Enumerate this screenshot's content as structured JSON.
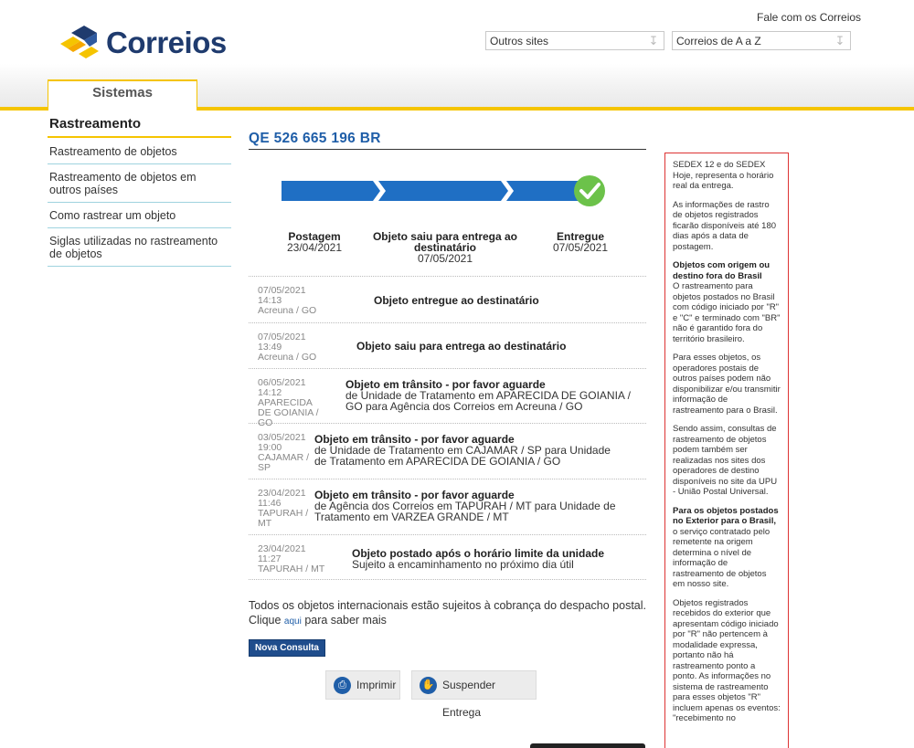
{
  "header": {
    "logo_text": "Correios",
    "fale_link": "Fale com os Correios",
    "select_outros": "Outros sites",
    "select_az": "Correios de A a Z",
    "tab_label": "Sistemas"
  },
  "sidebar": {
    "title": "Rastreamento",
    "items": [
      {
        "label": "Rastreamento de objetos"
      },
      {
        "label": "Rastreamento de objetos em outros países"
      },
      {
        "label": "Como rastrear um objeto"
      },
      {
        "label": "Siglas utilizadas no rastreamento de objetos"
      }
    ]
  },
  "tracking": {
    "code": "QE 526 665 196 BR",
    "progress_steps_completed": 3,
    "progress_steps_total": 3,
    "summary": {
      "posted_label": "Postagem",
      "posted_date": "23/04/2021",
      "out_label": "Objeto saiu para entrega ao destinatário",
      "out_date": "07/05/2021",
      "delivered_label": "Entregue",
      "delivered_date": "07/05/2021"
    },
    "events": [
      {
        "date": "07/05/2021",
        "time": "14:13",
        "place": "Acreuna / GO",
        "title": "Objeto entregue ao destinatário",
        "detail": ""
      },
      {
        "date": "07/05/2021",
        "time": "13:49",
        "place": "Acreuna / GO",
        "title": "Objeto saiu para entrega ao destinatário",
        "detail": ""
      },
      {
        "date": "06/05/2021",
        "time": "14:12",
        "place": "APARECIDA DE GOIANIA / GO",
        "title": "Objeto em trânsito - por favor aguarde",
        "detail": "de Unidade de Tratamento em APARECIDA DE GOIANIA / GO para Agência dos Correios em Acreuna / GO"
      },
      {
        "date": "03/05/2021",
        "time": "19:00",
        "place": "CAJAMAR / SP",
        "title": "Objeto em trânsito - por favor aguarde",
        "detail": "de Unidade de Tratamento em CAJAMAR / SP para Unidade de Tratamento em APARECIDA DE GOIANIA / GO"
      },
      {
        "date": "23/04/2021",
        "time": "11:46",
        "place": "TAPURAH / MT",
        "title": "Objeto em trânsito - por favor aguarde",
        "detail": "de Agência dos Correios em TAPURAH / MT para Unidade de Tratamento em VARZEA GRANDE / MT"
      },
      {
        "date": "23/04/2021",
        "time": "11:27",
        "place": "TAPURAH / MT",
        "title": "Objeto postado após o horário limite da unidade",
        "detail": "Sujeito a encaminhamento no próximo dia útil"
      }
    ],
    "note_line1": "Todos os objetos internacionais estão sujeitos à cobrança do despacho postal.",
    "note_clique": "Clique",
    "note_link": "aqui",
    "note_end": "para saber mais",
    "btn_nova": "Nova Consulta",
    "btn_print": "Imprimir",
    "btn_suspend": "Suspender Entrega"
  },
  "infobox": {
    "p1": "SEDEX 12 e do SEDEX Hoje, representa o horário real da entrega.",
    "p2": "As informações de rastro de objetos registrados ficarão disponíveis até 180 dias após a data de postagem.",
    "p3_title": "Objetos com origem ou destino fora do Brasil",
    "p3": "O rastreamento para objetos postados no Brasil com código iniciado por \"R\" e \"C\" e terminado com \"BR\" não é garantido fora do território brasileiro.",
    "p4": "Para esses objetos, os operadores postais de outros países podem não disponibilizar e/ou transmitir informação de rastreamento para o Brasil.",
    "p5": "Sendo assim, consultas de rastreamento de objetos podem também ser realizadas nos sites dos operadores de destino disponíveis no site da UPU - União Postal Universal.",
    "p6_title": "Para os objetos postados no Exterior para o Brasil,",
    "p6": "o serviço contratado pelo remetente na origem determina o nível de informação de rastreamento de objetos em nosso site.",
    "p7": "Objetos registrados recebidos do exterior que apresentam código iniciado por \"R\" não pertencem à modalidade expressa, portanto não há rastreamento ponto a ponto. As informações no sistema de rastreamento para esses objetos \"R\" incluem apenas os eventos: \"recebimento no"
  },
  "colors": {
    "brand_blue": "#1f3b6e",
    "link_blue": "#1f5ea8",
    "progress_blue": "#1f6fc4",
    "success_green": "#6cc24a",
    "accent_yellow": "#f5c400",
    "infobox_border": "#dd3333"
  }
}
